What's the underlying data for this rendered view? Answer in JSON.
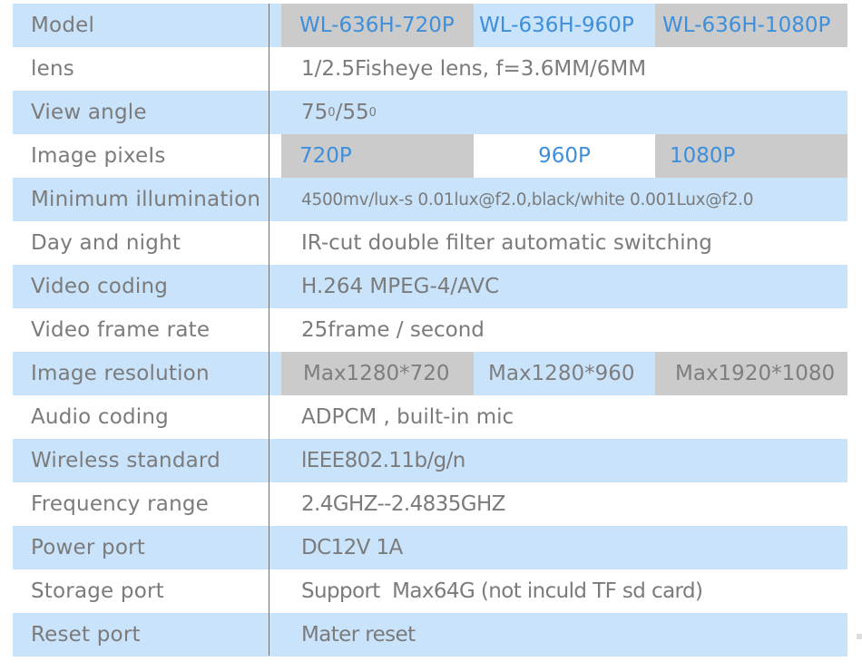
{
  "spec_table": {
    "model": {
      "label": "Model",
      "values": [
        "WL-636H-720P",
        "WL-636H-960P",
        "WL-636H-1080P"
      ]
    },
    "lens": {
      "label": "lens",
      "value": "1/2.5Fisheye lens, f=3.6MM/6MM"
    },
    "view_angle": {
      "label": "View angle",
      "value_a": "75",
      "value_a_sup": "0",
      "sep": "/",
      "value_b": "55",
      "value_b_sup": "0"
    },
    "image_pixels": {
      "label": "Image pixeIs",
      "values": [
        "720P",
        "960P",
        "1080P"
      ]
    },
    "minimum_illumination": {
      "label": "Minimum illumination",
      "value": "4500mv/lux-s 0.01lux@f2.0,black/white 0.001Lux@f2.0"
    },
    "day_and_night": {
      "label": "Day and night",
      "value": "IR-cut double filter automatic switching"
    },
    "video_coding": {
      "label": "Video coding",
      "value": "H.264 MPEG-4/AVC"
    },
    "video_frame_rate": {
      "label": "Video frame rate",
      "value": "25frame / second"
    },
    "image_resolution": {
      "label": "Image resolution",
      "values": [
        "Max1280*720",
        "Max1280*960",
        "Max1920*1080"
      ]
    },
    "audio_coding": {
      "label": "Audio coding",
      "value": "ADPCM , built-in mic"
    },
    "wireless_standard": {
      "label": "Wireless standard",
      "value": "lEEE802.11b/g/n"
    },
    "frequency_range": {
      "label": "Frequency range",
      "value": "2.4GHZ--2.4835GHZ"
    },
    "power_port": {
      "label": "Power port",
      "value": "DC12V 1A"
    },
    "storage_port": {
      "label": "Storage port",
      "value": "Support  Max64G (not inculd TF sd card)"
    },
    "reset_port": {
      "label": "Reset port",
      "value": "Mater reset"
    }
  },
  "colors": {
    "row_blue": "#c9e3fb",
    "cell_gray": "#cbcbcb",
    "accent_text": "#3d8fdc",
    "body_text": "#7b7b7b"
  }
}
